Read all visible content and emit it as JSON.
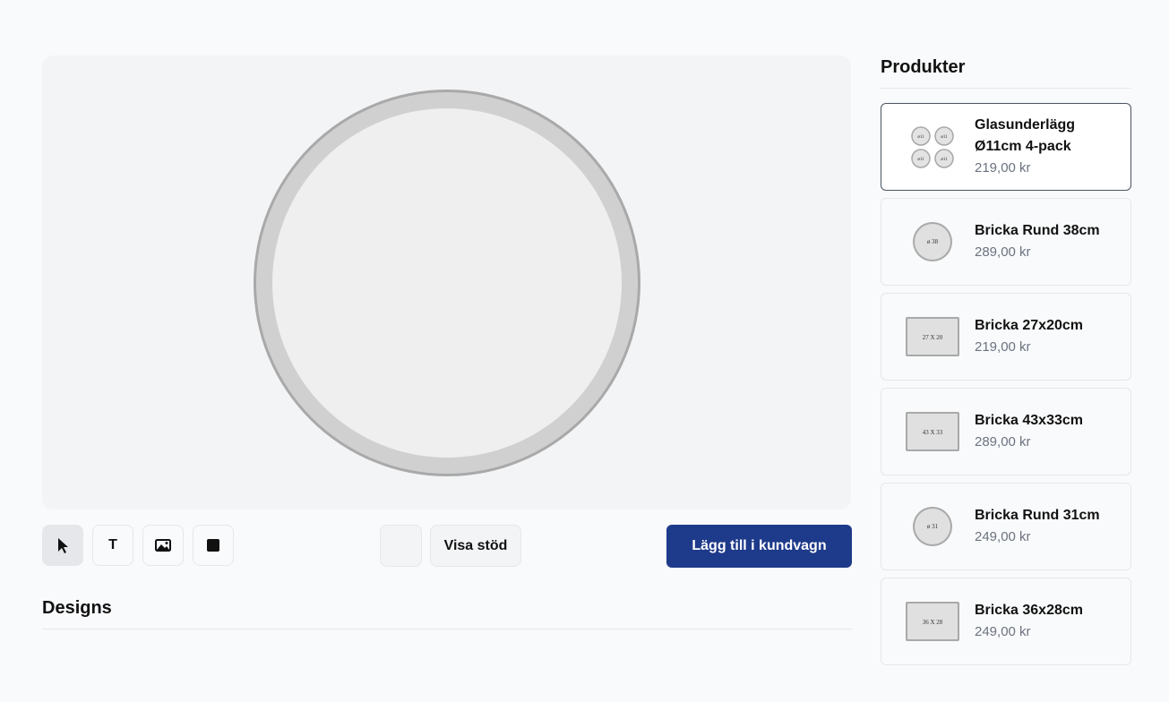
{
  "toolbar": {
    "tools": [
      {
        "name": "select-tool",
        "icon": "cursor-icon",
        "active": true
      },
      {
        "name": "text-tool",
        "label": "T",
        "icon": "text-icon"
      },
      {
        "name": "image-tool",
        "icon": "image-icon"
      },
      {
        "name": "shape-tool",
        "icon": "square-icon"
      }
    ],
    "visa_label": "Visa stöd",
    "cart_label": "Lägg till i kundvagn"
  },
  "designs": {
    "title": "Designs"
  },
  "products": {
    "title": "Produkter",
    "items": [
      {
        "name_line1": "Glasunderlägg",
        "name_line2": "Ø11cm 4-pack",
        "price": "219,00 kr",
        "selected": true,
        "thumb": "coasters",
        "thumb_labels": [
          "ø11",
          "ø11",
          "ø11",
          "ø11"
        ]
      },
      {
        "name": "Bricka Rund 38cm",
        "price": "289,00 kr",
        "thumb": "round",
        "thumb_label": "ø 38"
      },
      {
        "name": "Bricka 27x20cm",
        "price": "219,00 kr",
        "thumb": "rect",
        "thumb_label": "27 X 20"
      },
      {
        "name": "Bricka 43x33cm",
        "price": "289,00 kr",
        "thumb": "rect",
        "thumb_label": "43 X 33"
      },
      {
        "name": "Bricka Rund 31cm",
        "price": "249,00 kr",
        "thumb": "round",
        "thumb_label": "ø 31"
      },
      {
        "name": "Bricka 36x28cm",
        "price": "249,00 kr",
        "thumb": "rect",
        "thumb_label": "36 X 28"
      }
    ]
  },
  "colors": {
    "accent": "#1e3a8a",
    "canvas": "#f3f4f6",
    "tray_rim": "#d1d1d1",
    "tray_surface": "#efefef"
  }
}
